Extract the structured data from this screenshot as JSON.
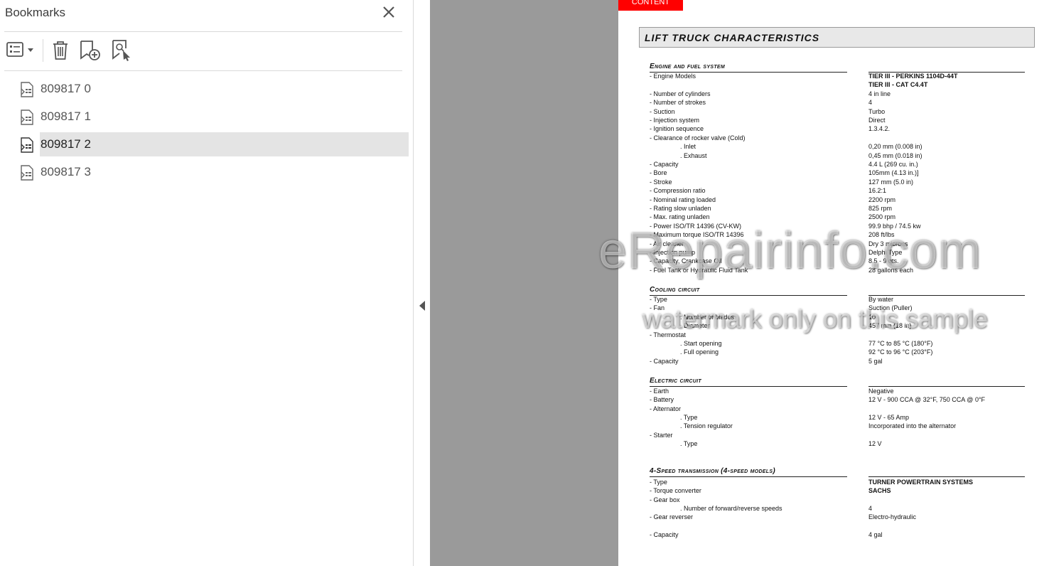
{
  "panel": {
    "title": "Bookmarks",
    "items": [
      {
        "label": "809817 0"
      },
      {
        "label": "809817 1"
      },
      {
        "label": "809817 2"
      },
      {
        "label": "809817 3"
      }
    ],
    "selected_index": 2
  },
  "document": {
    "content_tab": "CONTENT",
    "title": "LIFT TRUCK CHARACTERISTICS",
    "sections": [
      {
        "title": "Engine and fuel system"
      },
      {
        "title": "Cooling circuit"
      },
      {
        "title": "Electric circuit"
      },
      {
        "title": "4-Speed transmission (4-speed models)"
      }
    ],
    "engine_rows": [
      {
        "l": "- Engine Models",
        "r": "TIER III - PERKINS 1104D-44T",
        "bold": true
      },
      {
        "l": "",
        "r": "TIER III - CAT C4.4T",
        "bold": true
      },
      {
        "l": "- Number of cylinders",
        "r": "4 in line"
      },
      {
        "l": "- Number of strokes",
        "r": "4"
      },
      {
        "l": "- Suction",
        "r": "Turbo"
      },
      {
        "l": "- Injection system",
        "r": "Direct"
      },
      {
        "l": "- Ignition sequence",
        "r": "1.3.4.2."
      },
      {
        "l": "- Clearance of rocker valve (Cold)",
        "r": ""
      },
      {
        "l": ". Inlet",
        "r": "0,20 mm (0.008 in)",
        "sub": true
      },
      {
        "l": ". Exhaust",
        "r": "0,45 mm (0.018 in)",
        "sub": true
      },
      {
        "l": "- Capacity",
        "r": "4.4 L (269 cu. in.)"
      },
      {
        "l": "- Bore",
        "r": "105mm (4.13 in.)]"
      },
      {
        "l": "- Stroke",
        "r": "127 mm (5.0 in)"
      },
      {
        "l": "- Compression ratio",
        "r": "16.2:1"
      },
      {
        "l": "- Nominal rating loaded",
        "r": "2200 rpm"
      },
      {
        "l": "- Rating slow unladen",
        "r": "825 rpm"
      },
      {
        "l": "- Max. rating unladen",
        "r": "2500 rpm"
      },
      {
        "l": "- Power ISO/TR 14396 (CV-KW)",
        "r": "99.9 bhp / 74.5 kw"
      },
      {
        "l": "- Maximum torque ISO/TR 14396",
        "r": "208 ft/lbs"
      },
      {
        "l": "- Air cleaner",
        "r": "Dry 3 microns"
      },
      {
        "l": "- Injection pump",
        "r": "Delphi Type"
      },
      {
        "l": "- Capacity, Crankcase Oil",
        "r": "8.5 - 9 qts."
      },
      {
        "l": "- Fuel Tank or Hydraulic Fluid Tank",
        "r": "28 gallons each"
      }
    ],
    "cooling_rows": [
      {
        "l": "- Type",
        "r": "By water"
      },
      {
        "l": "- Fan",
        "r": "Suction (Puller)"
      },
      {
        "l": ". Number of blades",
        "r": "10",
        "sub": true
      },
      {
        "l": ". Diameter",
        "r": "457 mm (18 in)",
        "sub": true
      },
      {
        "l": "- Thermostat",
        "r": ""
      },
      {
        "l": ". Start opening",
        "r": "77 °C to 85 °C (180°F)",
        "sub": true
      },
      {
        "l": ". Full opening",
        "r": "92 °C to 96 °C (203°F)",
        "sub": true
      },
      {
        "l": "- Capacity",
        "r": "5 gal"
      }
    ],
    "electric_rows": [
      {
        "l": "- Earth",
        "r": "Negative"
      },
      {
        "l": "- Battery",
        "r": "12 V - 900 CCA @ 32°F, 750 CCA @ 0°F"
      },
      {
        "l": "- Alternator",
        "r": ""
      },
      {
        "l": ". Type",
        "r": "12 V - 65 Amp",
        "sub": true
      },
      {
        "l": ". Tension regulator",
        "r": "Incorporated into the alternator",
        "sub": true
      },
      {
        "l": "- Starter",
        "r": ""
      },
      {
        "l": ". Type",
        "r": "12 V",
        "sub": true
      }
    ],
    "transmission_rows": [
      {
        "l": "- Type",
        "r": "TURNER POWERTRAIN SYSTEMS",
        "bold": true
      },
      {
        "l": "- Torque converter",
        "r": "SACHS",
        "bold": true
      },
      {
        "l": "- Gear box",
        "r": ""
      },
      {
        "l": ". Number of forward/reverse speeds",
        "r": "4",
        "sub": true
      },
      {
        "l": "- Gear reverser",
        "r": "Electro-hydraulic"
      },
      {
        "l": "",
        "r": ""
      },
      {
        "l": "- Capacity",
        "r": "4 gal"
      }
    ]
  },
  "watermark": {
    "line1": "eRepairinfo.com",
    "line2": "watermark only on this sample"
  }
}
